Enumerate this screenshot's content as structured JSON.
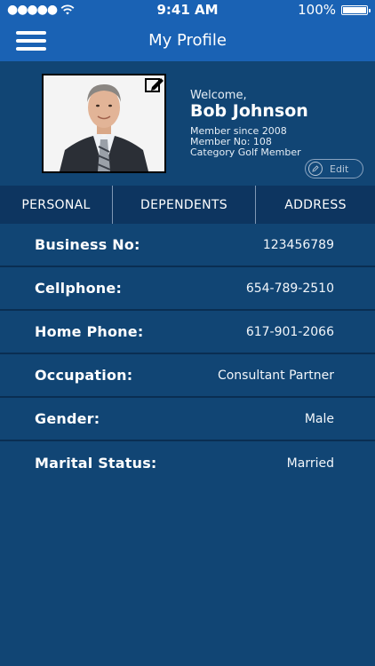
{
  "status_bar": {
    "signal": "●●●●●",
    "time": "9:41 AM",
    "battery": "100%"
  },
  "nav": {
    "title": "My Profile"
  },
  "profile": {
    "welcome": "Welcome,",
    "name": "Bob Johnson",
    "member_since": "Member since 2008",
    "member_no": "Member No: 108",
    "category": "Category Golf Member",
    "edit_label": "Edit"
  },
  "tabs": [
    {
      "label": "PERSONAL"
    },
    {
      "label": "DEPENDENTS"
    },
    {
      "label": "ADDRESS"
    }
  ],
  "fields": [
    {
      "label": "Business No:",
      "value": "123456789"
    },
    {
      "label": "Cellphone:",
      "value": "654-789-2510"
    },
    {
      "label": "Home Phone:",
      "value": "617-901-2066"
    },
    {
      "label": "Occupation:",
      "value": "Consultant Partner"
    },
    {
      "label": "Gender:",
      "value": "Male"
    },
    {
      "label": "Marital Status:",
      "value": "Married"
    }
  ],
  "colors": {
    "nav": "#1a62b4",
    "background": "#114574",
    "tabs": "#0d3560"
  }
}
